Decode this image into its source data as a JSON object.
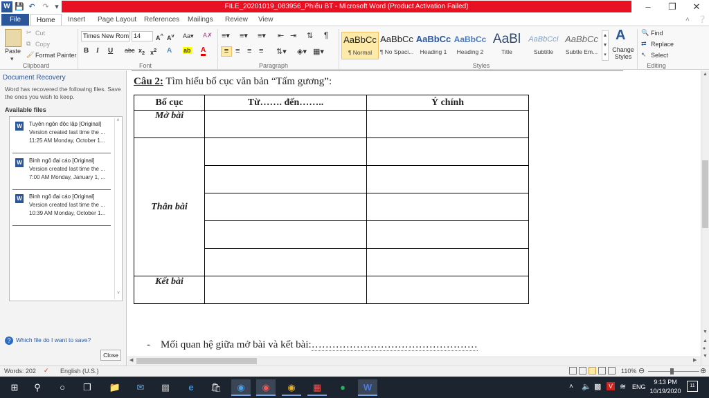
{
  "window": {
    "title": "FILE_20201019_083956_Phiếu BT  -  Microsoft Word (Product Activation Failed)"
  },
  "tabs": [
    "File",
    "Home",
    "Insert",
    "Page Layout",
    "References",
    "Mailings",
    "Review",
    "View"
  ],
  "ribbon": {
    "clipboard": {
      "paste": "Paste",
      "cut": "Cut",
      "copy": "Copy",
      "format_painter": "Format Painter",
      "label": "Clipboard"
    },
    "font": {
      "name": "Times New Rom",
      "size": "14",
      "label": "Font"
    },
    "paragraph": {
      "label": "Paragraph"
    },
    "styles": {
      "label": "Styles",
      "items": [
        {
          "sample": "AaBbCc",
          "name": "¶ Normal"
        },
        {
          "sample": "AaBbCc",
          "name": "¶ No Spaci..."
        },
        {
          "sample": "AaBbCc",
          "name": "Heading 1"
        },
        {
          "sample": "AaBbCc",
          "name": "Heading 2"
        },
        {
          "sample": "AaBl",
          "name": "Title"
        },
        {
          "sample": "AaBbCcI",
          "name": "Subtitle"
        },
        {
          "sample": "AaBbCc",
          "name": "Subtle Em..."
        }
      ],
      "change": "Change Styles"
    },
    "editing": {
      "find": "Find",
      "replace": "Replace",
      "select": "Select",
      "label": "Editing"
    }
  },
  "recovery": {
    "title": "Document Recovery",
    "description": "Word has recovered the following files.  Save the ones you wish to keep.",
    "available": "Available files",
    "files": [
      {
        "name": "Tuyên ngôn độc lập  [Original]",
        "version": "Version created last time the ...",
        "time": "11:25 AM Monday, October 1..."
      },
      {
        "name": "Bình ngô đại cáo  [Original]",
        "version": "Version created last time the ...",
        "time": "7:00 AM Monday, January 1, ..."
      },
      {
        "name": "Bình ngô đại cáo  [Original]",
        "version": "Version created last time the ...",
        "time": "10:39 AM Monday, October 1..."
      }
    ],
    "help": "Which file do I want to save?",
    "close": "Close"
  },
  "document": {
    "heading_label": "Câu 2:",
    "heading_text": " Tìm hiểu bố cục văn bản “Tấm gương”:",
    "table_headers": [
      "Bố cục",
      "Từ……. đến……..",
      "Ý  chính"
    ],
    "rows": {
      "mo_bai": "Mở bài",
      "than_bai": "Thân bài",
      "ket_bai": "Kết bài"
    },
    "bullet_dash": "-",
    "bullet_text": "Mối quan hệ giữa mở bài và kết bài:",
    "bullet_dots": "…………………………………………"
  },
  "status": {
    "words": "Words: 202",
    "language": "English (U.S.)",
    "zoom": "110%"
  },
  "taskbar": {
    "language": "ENG",
    "time": "9:13 PM",
    "date": "10/19/2020",
    "notifications": "11"
  }
}
